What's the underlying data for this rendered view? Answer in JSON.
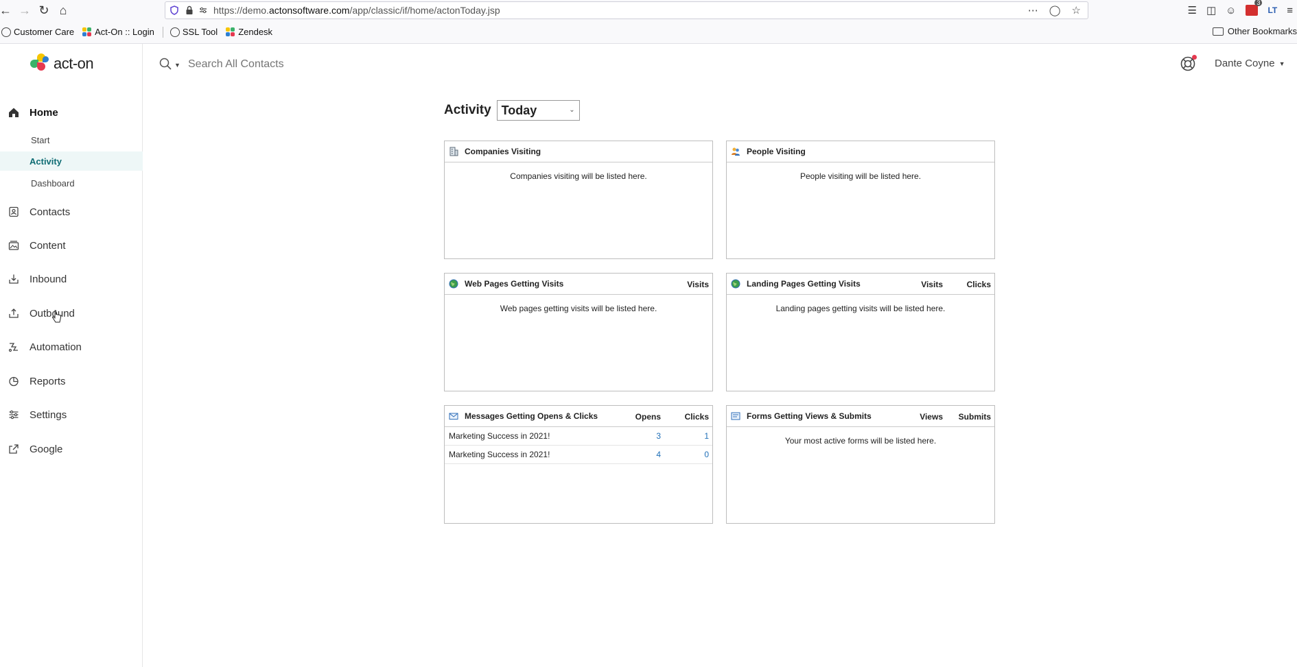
{
  "browser": {
    "url_prefix": "https://demo.",
    "url_domain": "actonsoftware.com",
    "url_path": "/app/classic/if/home/actonToday.jsp",
    "extension_badge": "3",
    "bookmarks": [
      "Customer Care",
      "Act-On :: Login",
      "SSL Tool",
      "Zendesk"
    ],
    "other_bookmarks": "Other Bookmarks"
  },
  "app": {
    "logo_text": "act-on",
    "search_placeholder": "Search All Contacts",
    "user_name": "Dante Coyne",
    "brand_colors": {
      "teal": "#0f6d74",
      "yellow": "#f6c500",
      "red": "#e53950",
      "green": "#3bb26a",
      "blue": "#2f7fd1"
    }
  },
  "sidebar": {
    "home": "Home",
    "sub_items": [
      {
        "label": "Start",
        "active": false
      },
      {
        "label": "Activity",
        "active": true
      },
      {
        "label": "Dashboard",
        "active": false
      }
    ],
    "items": [
      {
        "label": "Contacts",
        "icon": "contacts-icon"
      },
      {
        "label": "Content",
        "icon": "content-icon"
      },
      {
        "label": "Inbound",
        "icon": "inbound-icon"
      },
      {
        "label": "Outbound",
        "icon": "outbound-icon"
      },
      {
        "label": "Automation",
        "icon": "automation-icon"
      },
      {
        "label": "Reports",
        "icon": "reports-icon"
      },
      {
        "label": "Settings",
        "icon": "settings-icon"
      },
      {
        "label": "Google",
        "icon": "external-link-icon"
      }
    ]
  },
  "activity": {
    "title": "Activity",
    "period": "Today",
    "panels": {
      "companies": {
        "title": "Companies Visiting",
        "empty": "Companies visiting will be listed here."
      },
      "people": {
        "title": "People Visiting",
        "empty": "People visiting will be listed here."
      },
      "web_pages": {
        "title": "Web Pages Getting Visits",
        "col1": "Visits",
        "empty": "Web pages getting visits will be listed here."
      },
      "landing_pages": {
        "title": "Landing Pages Getting Visits",
        "col1": "Visits",
        "col2": "Clicks",
        "empty": "Landing pages getting visits will be listed here."
      },
      "messages": {
        "title": "Messages Getting Opens & Clicks",
        "col1": "Opens",
        "col2": "Clicks",
        "rows": [
          {
            "name": "Marketing Success in 2021!",
            "opens": "3",
            "clicks": "1"
          },
          {
            "name": "Marketing Success in 2021!",
            "opens": "4",
            "clicks": "0"
          }
        ]
      },
      "forms": {
        "title": "Forms Getting Views & Submits",
        "col1": "Views",
        "col2": "Submits",
        "empty": "Your most active forms will be listed here."
      }
    }
  }
}
